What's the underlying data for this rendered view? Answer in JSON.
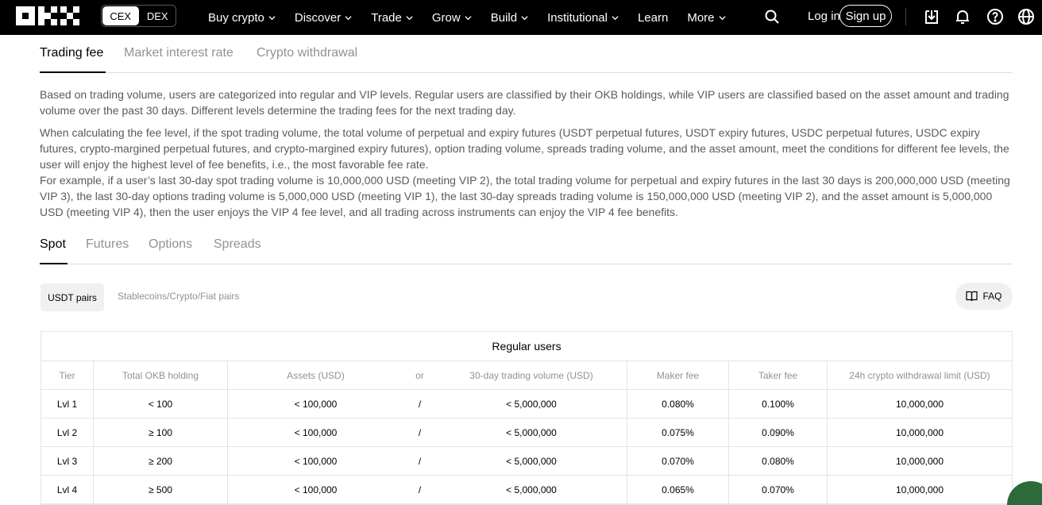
{
  "nav": {
    "exchange_toggle": [
      "CEX",
      "DEX"
    ],
    "menu": [
      {
        "label": "Buy crypto",
        "has_chevron": true
      },
      {
        "label": "Discover",
        "has_chevron": true
      },
      {
        "label": "Trade",
        "has_chevron": true
      },
      {
        "label": "Grow",
        "has_chevron": true
      },
      {
        "label": "Build",
        "has_chevron": true
      },
      {
        "label": "Institutional",
        "has_chevron": true
      },
      {
        "label": "Learn",
        "has_chevron": false
      },
      {
        "label": "More",
        "has_chevron": true
      }
    ],
    "login": "Log in",
    "signup": "Sign up",
    "icons": [
      "search-icon",
      "download-icon",
      "bell-icon",
      "help-icon",
      "globe-icon"
    ]
  },
  "tabs": [
    "Trading fee",
    "Market interest rate",
    "Crypto withdrawal"
  ],
  "intro": {
    "p1": "Based on trading volume, users are categorized into regular and VIP levels. Regular users are classified by their OKB holdings, while VIP users are classified based on the asset amount and trading volume over the past 30 days. Different levels determine the trading fees for the next trading day.",
    "p2": "When calculating the fee level, if the spot trading volume, the total volume of perpetual and expiry futures (USDT perpetual futures, USDT expiry futures, USDC perpetual futures, USDC expiry futures, crypto-margined perpetual futures, and crypto-margined expiry futures), option trading volume, spreads trading volume, and the asset amount, meet the conditions for different fee levels, the user will enjoy the highest level of fee benefits, i.e., the most favorable fee rate.",
    "p3": "For example, if a user’s last 30-day spot trading volume is 10,000,000 USD (meeting VIP 2), the total trading volume for perpetual and expiry futures in the last 30 days is 200,000,000 USD (meeting VIP 3), the last 30-day options trading volume is 5,000,000 USD (meeting VIP 1), the last 30-day spreads trading volume is 150,000,000 USD (meeting VIP 2), and the asset amount is 5,000,000 USD (meeting VIP 4), then the user enjoys the VIP 4 fee level, and all trading across instruments can enjoy the VIP 4 fee benefits."
  },
  "product_tabs": [
    "Spot",
    "Futures",
    "Options",
    "Spreads"
  ],
  "pair_filters": [
    "USDT pairs",
    "Stablecoins/Crypto/Fiat pairs"
  ],
  "faq_label": "FAQ",
  "table": {
    "caption": "Regular users",
    "headers": [
      "Tier",
      "Total OKB holding",
      "Assets (USD)",
      "or",
      "30-day trading volume (USD)",
      "Maker fee",
      "Taker fee",
      "24h crypto withdrawal limit (USD)"
    ],
    "rows": [
      [
        "Lvl 1",
        "< 100",
        "< 100,000",
        "/",
        "< 5,000,000",
        "0.080%",
        "0.100%",
        "10,000,000"
      ],
      [
        "Lvl 2",
        "≥ 100",
        "< 100,000",
        "/",
        "< 5,000,000",
        "0.075%",
        "0.090%",
        "10,000,000"
      ],
      [
        "Lvl 3",
        "≥ 200",
        "< 100,000",
        "/",
        "< 5,000,000",
        "0.070%",
        "0.080%",
        "10,000,000"
      ],
      [
        "Lvl 4",
        "≥ 500",
        "< 100,000",
        "/",
        "< 5,000,000",
        "0.065%",
        "0.070%",
        "10,000,000"
      ]
    ]
  }
}
